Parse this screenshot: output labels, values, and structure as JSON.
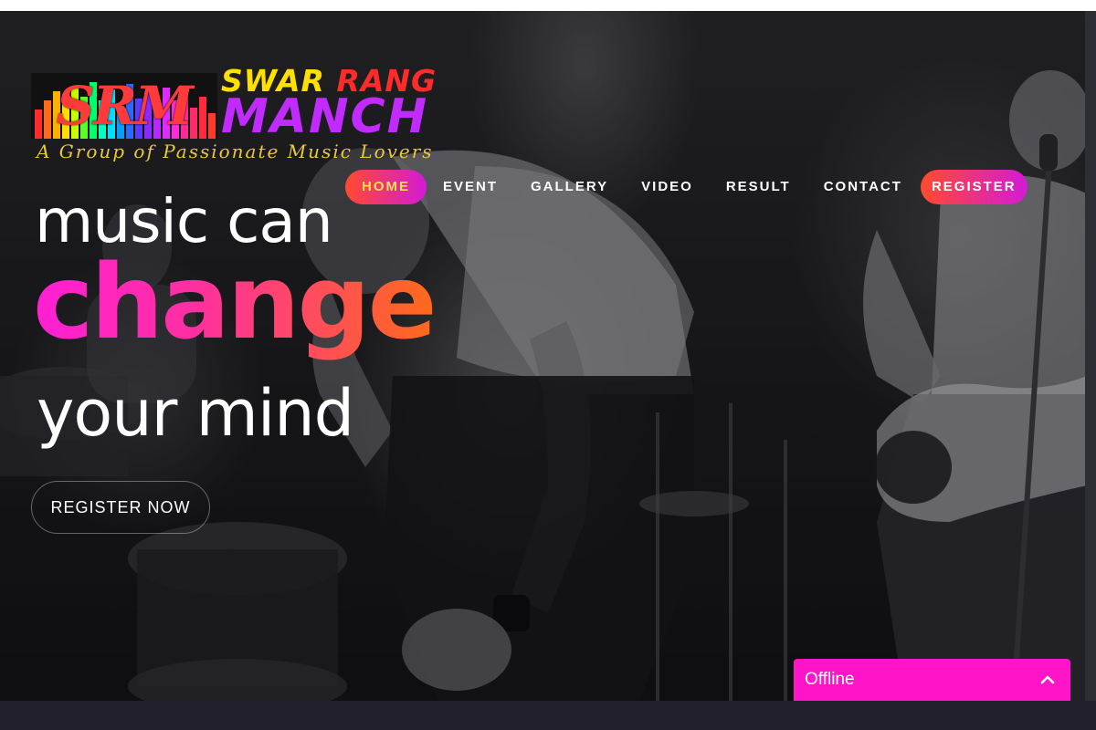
{
  "logo": {
    "mark": "SRM",
    "name_part1": "SWAR",
    "name_part2": "RANG",
    "name_part3": "MANCH",
    "tagline": "A Group of Passionate Music Lovers"
  },
  "nav": {
    "items": [
      {
        "label": "HOME",
        "active": true
      },
      {
        "label": "EVENT"
      },
      {
        "label": "GALLERY"
      },
      {
        "label": "VIDEO"
      },
      {
        "label": "RESULT"
      },
      {
        "label": "CONTACT"
      },
      {
        "label": "REGISTER",
        "highlight": true
      }
    ]
  },
  "hero": {
    "line1": "music can",
    "line2": "change",
    "line3": "your mind",
    "cta_label": "REGISTER NOW"
  },
  "chat": {
    "status": "Offline",
    "icon": "chevron-up-icon"
  },
  "colors": {
    "accent_gradient_start": "#ff4a2e",
    "accent_gradient_end": "#d41ad8",
    "chat_background": "#ff14c8",
    "active_nav_text": "#ffe14a"
  }
}
